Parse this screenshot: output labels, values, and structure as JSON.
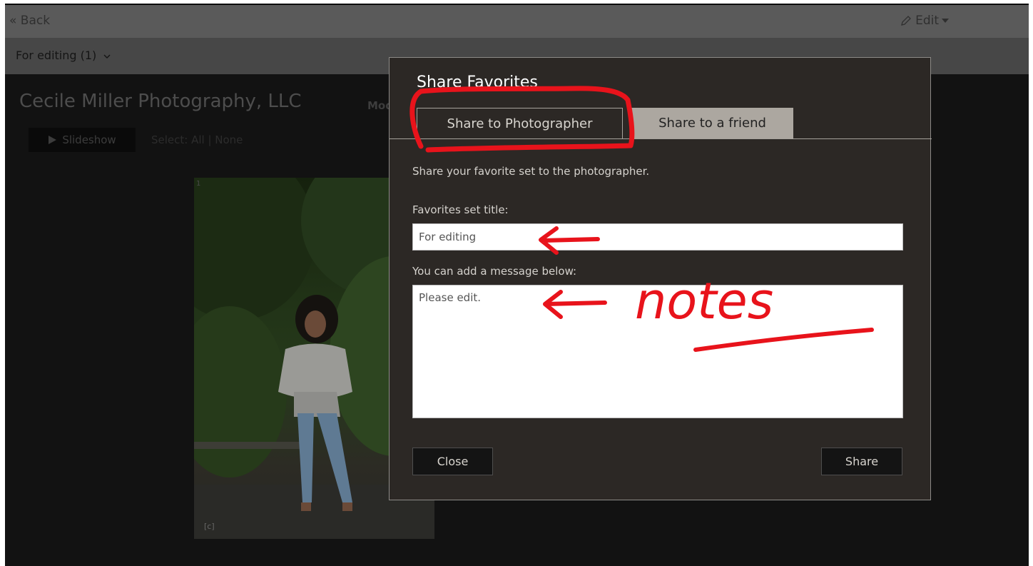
{
  "topbar": {
    "back_label": "« Back",
    "edit_label": "Edit"
  },
  "subbar": {
    "selection_label": "For editing (1)"
  },
  "gallery": {
    "title": "Cecile Miller Photography, LLC",
    "subtitle_partial": "Mod",
    "slideshow_label": "Slideshow",
    "select_label": "Select: All | None",
    "photo_number": "1"
  },
  "modal": {
    "title": "Share Favorites",
    "tabs": [
      {
        "label": "Share to Photographer",
        "active": true
      },
      {
        "label": "Share to a friend",
        "active": false
      }
    ],
    "description": "Share your favorite set to the photographer.",
    "set_title_label": "Favorites set title:",
    "set_title_value": "For editing",
    "message_label": "You can add a message below:",
    "message_value": "Please edit.",
    "close_label": "Close",
    "share_label": "Share"
  },
  "annotation": {
    "note_text": "notes",
    "color": "#e8131b"
  },
  "colors": {
    "overlay_bg": "#121212",
    "modal_bg": "#2c2825",
    "tab_inactive": "#aca7a0"
  }
}
